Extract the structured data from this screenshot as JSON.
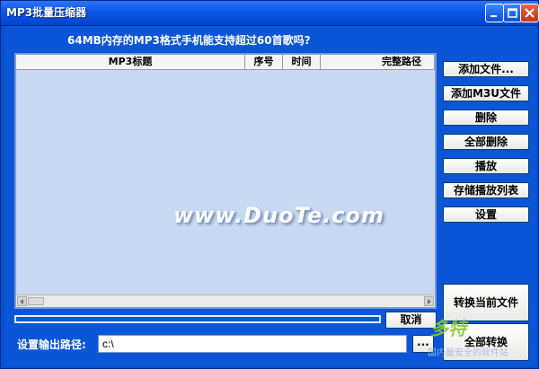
{
  "window": {
    "title": "MP3批量压缩器"
  },
  "question": "64MB内存的MP3格式手机能支持超过60首歌吗?",
  "list": {
    "columns": [
      "MP3标题",
      "序号",
      "时间",
      "完整路径"
    ],
    "rows": []
  },
  "watermark": "www.DuoTe.com",
  "buttons": {
    "add_file": "添加文件...",
    "add_m3u": "添加M3U文件",
    "delete": "删除",
    "delete_all": "全部删除",
    "play": "播放",
    "save_playlist": "存储播放列表",
    "settings": "设置",
    "convert_current": "转换当前文件",
    "convert_all": "全部转换",
    "cancel": "取消",
    "browse": "..."
  },
  "progress": {
    "value": 0
  },
  "output": {
    "label": "设置输出路径:",
    "value": "c:\\"
  },
  "corner_logo": {
    "text1": "多特",
    "text2": "国内最安全的软件站"
  },
  "colors": {
    "window_blue": "#0a56d6",
    "title_blue": "#0a57e4",
    "list_bg": "#c9d9f1"
  },
  "icons": {
    "minimize": "minimize-icon",
    "maximize": "maximize-icon",
    "close": "close-icon"
  }
}
